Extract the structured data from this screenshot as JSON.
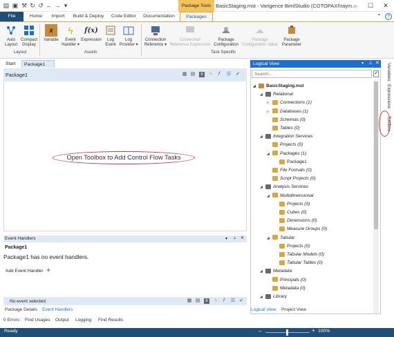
{
  "window": {
    "title": "BasicStaging.mst - Varigence BimlStudio (COTOPAXI\\raym...",
    "context_tab": "Package Tools"
  },
  "ribbon_tabs": [
    "File",
    "Home",
    "Import",
    "Build & Deploy",
    "Code Editor",
    "Documentation",
    "Packages"
  ],
  "ribbon": {
    "groups": [
      "Layout",
      "Assets",
      "Task Specific"
    ],
    "layout_buttons": [
      {
        "label1": "Auto",
        "label2": "Layout",
        "icon": "auto-layout-icon"
      },
      {
        "label1": "Compact",
        "label2": "Display",
        "icon": "compact-display-icon"
      }
    ],
    "asset_buttons": [
      {
        "label1": "Variable",
        "label2": "",
        "icon": "variable-icon"
      },
      {
        "label1": "Event",
        "label2": "Handler ▾",
        "icon": "event-handler-icon"
      },
      {
        "label1": "Expression",
        "label2": "",
        "icon": "expression-icon"
      },
      {
        "label1": "Log",
        "label2": "Event",
        "icon": "log-event-icon"
      },
      {
        "label1": "Log",
        "label2": "Provider ▾",
        "icon": "log-provider-icon"
      }
    ],
    "task_buttons": [
      {
        "label1": "Connection",
        "label2": "Reference ▾",
        "disabled": false
      },
      {
        "label1": "Connection",
        "label2": "Reference Expression",
        "disabled": true
      },
      {
        "label1": "Package",
        "label2": "Configuration",
        "disabled": false
      },
      {
        "label1": "Package",
        "label2": "Configuration Value",
        "disabled": true
      },
      {
        "label1": "Package",
        "label2": "Parameter",
        "disabled": false
      }
    ]
  },
  "doc_tabs": {
    "start": "Start",
    "package": "Package1",
    "close": "✕"
  },
  "designer": {
    "title": "Package1",
    "canvas_message": "Open Toolbox to Add Control Flow Tasks"
  },
  "event_handlers": {
    "panel_title": "Event Handlers",
    "package": "Package1",
    "message": "Package1 has no event handlers.",
    "add_label": "Add Event Handler",
    "footer": "No event selected"
  },
  "bottom_tabs": [
    "Package Details",
    "Event Handlers"
  ],
  "output_tabs": [
    "0 Errors",
    "Find Usages",
    "Output",
    "Logging",
    "Find Results"
  ],
  "logical_view": {
    "title": "Logical View",
    "search_placeholder": "Search...",
    "tree": [
      {
        "label": "BasicStaging.mst",
        "level": 0,
        "arrow": "◢",
        "bold": true
      },
      {
        "label": "Relational",
        "level": 1,
        "arrow": "◢"
      },
      {
        "label": "Connections (1)",
        "level": 2,
        "arrow": "▷"
      },
      {
        "label": "Databases (1)",
        "level": 2,
        "arrow": "▷"
      },
      {
        "label": "Schemas (0)",
        "level": 2,
        "arrow": ""
      },
      {
        "label": "Tables (0)",
        "level": 2,
        "arrow": ""
      },
      {
        "label": "Integration Services",
        "level": 1,
        "arrow": "◢"
      },
      {
        "label": "Projects (0)",
        "level": 2,
        "arrow": ""
      },
      {
        "label": "Packages (1)",
        "level": 2,
        "arrow": "◢"
      },
      {
        "label": "Package1",
        "level": 3,
        "arrow": "",
        "plain": true
      },
      {
        "label": "File Formats (0)",
        "level": 2,
        "arrow": ""
      },
      {
        "label": "Script Projects (0)",
        "level": 2,
        "arrow": ""
      },
      {
        "label": "Analysis Services",
        "level": 1,
        "arrow": "◢"
      },
      {
        "label": "Multidimensional",
        "level": 2,
        "arrow": "◢"
      },
      {
        "label": "Projects (0)",
        "level": 3,
        "arrow": ""
      },
      {
        "label": "Cubes (0)",
        "level": 3,
        "arrow": ""
      },
      {
        "label": "Dimensions (0)",
        "level": 3,
        "arrow": ""
      },
      {
        "label": "Measure Groups (0)",
        "level": 3,
        "arrow": ""
      },
      {
        "label": "Tabular",
        "level": 2,
        "arrow": "◢"
      },
      {
        "label": "Projects (0)",
        "level": 3,
        "arrow": ""
      },
      {
        "label": "Tabular Models (0)",
        "level": 3,
        "arrow": ""
      },
      {
        "label": "Tabular Tables (0)",
        "level": 3,
        "arrow": ""
      },
      {
        "label": "Metadata",
        "level": 1,
        "arrow": "◢"
      },
      {
        "label": "Principals (0)",
        "level": 2,
        "arrow": ""
      },
      {
        "label": "Metadata (0)",
        "level": 2,
        "arrow": ""
      },
      {
        "label": "Library",
        "level": 1,
        "arrow": "◢"
      }
    ],
    "bottom_tabs": [
      "Logical View",
      "Project View"
    ]
  },
  "side_tabs": [
    "Variables",
    "Expressions",
    "Toolbox"
  ],
  "status": {
    "text": "Ready",
    "zoom": "100%"
  },
  "colors": {
    "accent": "#1f4e79",
    "context": "#f3c25a",
    "panel": "#dfe9f6",
    "highlight": "#d23a3a"
  }
}
